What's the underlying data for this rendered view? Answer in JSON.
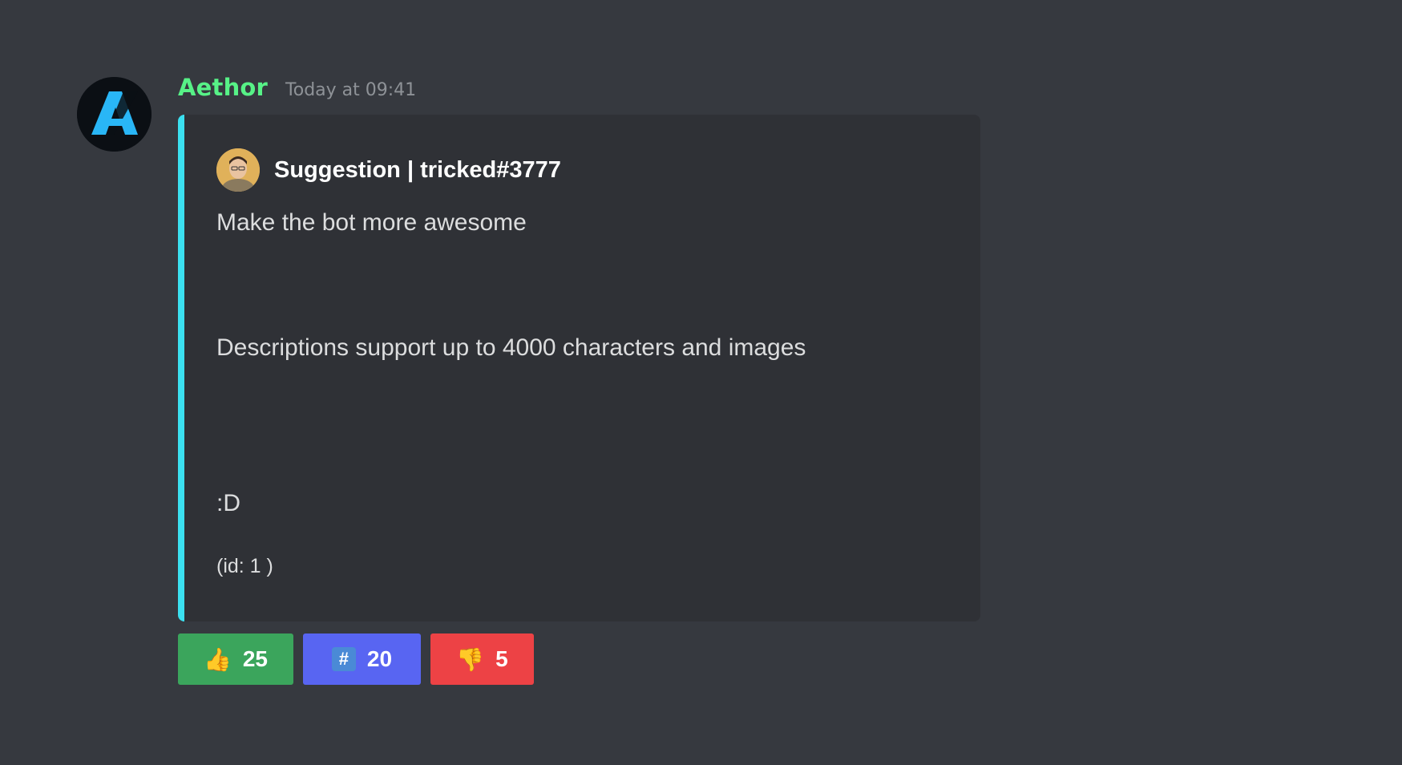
{
  "message": {
    "author": "Aethor",
    "author_color": "#57f287",
    "timestamp": "Today at 09:41",
    "avatar_icon": "aethor-logo-icon"
  },
  "embed": {
    "accent_color": "#3be0f0",
    "author_icon": "user-avatar-icon",
    "author_name": "Suggestion | tricked#3777",
    "description_lines": [
      "Make the bot more awesome",
      "Descriptions support up to 4000 characters and images",
      ":D"
    ],
    "footer": "(id: 1 )"
  },
  "buttons": [
    {
      "emoji": "thumbs-up-icon",
      "glyph": "👍",
      "label": "25",
      "color": "#3ba55c"
    },
    {
      "emoji": "hash-icon",
      "glyph": "#",
      "label": "20",
      "color": "#5865f2"
    },
    {
      "emoji": "thumbs-down-icon",
      "glyph": "👎",
      "label": "5",
      "color": "#ed4245"
    }
  ]
}
